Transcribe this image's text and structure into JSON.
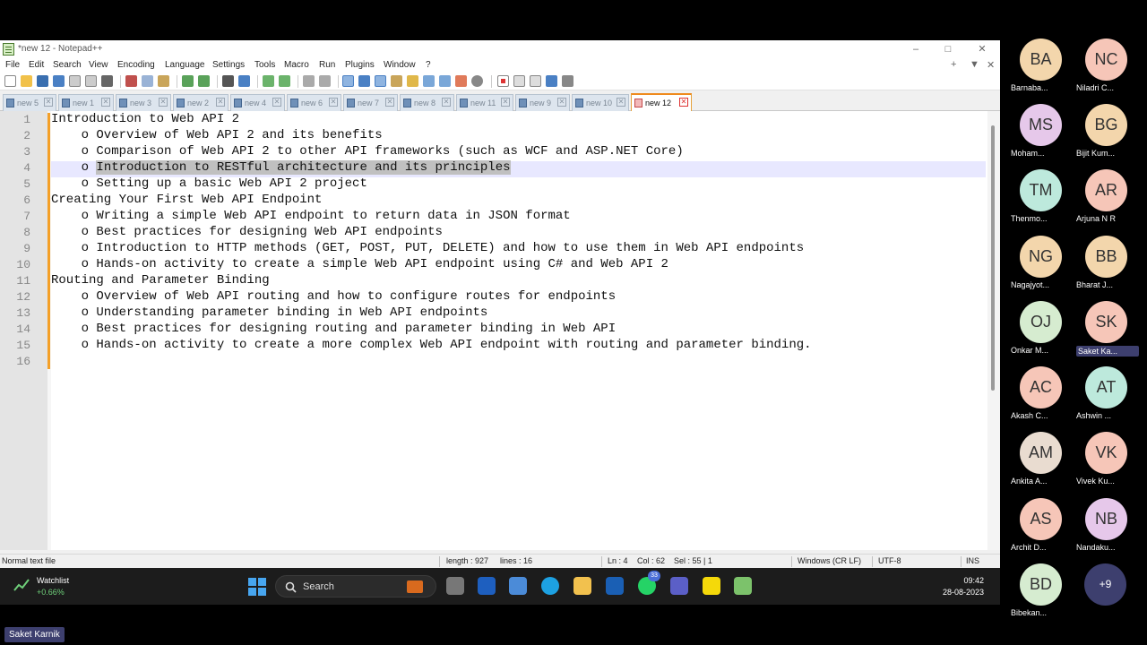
{
  "window": {
    "title": "*new 12 - Notepad++",
    "minimize": "–",
    "maximize": "□",
    "close": "✕"
  },
  "menu": [
    "File",
    "Edit",
    "Search",
    "View",
    "Encoding",
    "Language",
    "Settings",
    "Tools",
    "Macro",
    "Run",
    "Plugins",
    "Window",
    "?"
  ],
  "menu_right": [
    "+",
    "▼",
    "✕"
  ],
  "tabs": [
    {
      "label": "new 5"
    },
    {
      "label": "new 1"
    },
    {
      "label": "new 3"
    },
    {
      "label": "new 2"
    },
    {
      "label": "new 4"
    },
    {
      "label": "new 6"
    },
    {
      "label": "new 7"
    },
    {
      "label": "new 8"
    },
    {
      "label": "new 11"
    },
    {
      "label": "new 9"
    },
    {
      "label": "new 10"
    },
    {
      "label": "new 12"
    }
  ],
  "tab_close": "✕",
  "editor": {
    "lines": [
      "Introduction to Web API 2",
      "    o Overview of Web API 2 and its benefits",
      "    o Comparison of Web API 2 to other API frameworks (such as WCF and ASP.NET Core)",
      "    o ",
      "    o Setting up a basic Web API 2 project",
      "Creating Your First Web API Endpoint",
      "    o Writing a simple Web API endpoint to return data in JSON format",
      "    o Best practices for designing Web API endpoints",
      "    o Introduction to HTTP methods (GET, POST, PUT, DELETE) and how to use them in Web API endpoints",
      "    o Hands-on activity to create a simple Web API endpoint using C# and Web API 2",
      "Routing and Parameter Binding",
      "    o Overview of Web API routing and how to configure routes for endpoints",
      "    o Understanding parameter binding in Web API endpoints",
      "    o Best practices for designing routing and parameter binding in Web API",
      "    o Hands-on activity to create a more complex Web API endpoint with routing and parameter binding.",
      ""
    ],
    "selected_text": "Introduction to RESTful architecture and its principles",
    "current_line": 4
  },
  "status": {
    "file_type": "Normal text file",
    "length": "length : 927",
    "lines": "lines : 16",
    "ln": "Ln : 4",
    "col": "Col : 62",
    "sel": "Sel : 55 | 1",
    "eol": "Windows (CR LF)",
    "encoding": "UTF-8",
    "mode": "INS"
  },
  "taskbar": {
    "widget_name": "Watchlist",
    "widget_value": "+0.66%",
    "search": "Search",
    "badge": "33",
    "time": "09:42",
    "date": "28-08-2023"
  },
  "presenter": "Saket Karnik",
  "participants": [
    {
      "initials": "BA",
      "name": "Barnaba...",
      "color": "#f3d6ac"
    },
    {
      "initials": "NC",
      "name": "Niladri C...",
      "color": "#f6c6b8"
    },
    {
      "initials": "MS",
      "name": "Moham...",
      "color": "#e6c8ea"
    },
    {
      "initials": "BG",
      "name": "Bijit Kum...",
      "color": "#f3d6ac"
    },
    {
      "initials": "TM",
      "name": "Thenmo...",
      "color": "#bde9dc"
    },
    {
      "initials": "AR",
      "name": "Arjuna N R",
      "color": "#f6c6b8"
    },
    {
      "initials": "NG",
      "name": "Nagajyot...",
      "color": "#f3d6ac"
    },
    {
      "initials": "BB",
      "name": "Bharat J...",
      "color": "#f3d6ac"
    },
    {
      "initials": "OJ",
      "name": "Onkar M...",
      "color": "#d6ecd0"
    },
    {
      "initials": "SK",
      "name": "Saket Ka...",
      "color": "#f6c6b8"
    },
    {
      "initials": "AC",
      "name": "Akash C...",
      "color": "#f6c6b8"
    },
    {
      "initials": "AT",
      "name": "Ashwin ...",
      "color": "#bde9dc"
    },
    {
      "initials": "AM",
      "name": "Ankita A...",
      "color": "#e9dcd0"
    },
    {
      "initials": "VK",
      "name": "Vivek Ku...",
      "color": "#f6c6b8"
    },
    {
      "initials": "AS",
      "name": "Archit D...",
      "color": "#f6c6b8"
    },
    {
      "initials": "NB",
      "name": "Nandaku...",
      "color": "#e6c8ea"
    },
    {
      "initials": "BD",
      "name": "Bibekan...",
      "color": "#d6ecd0"
    }
  ],
  "more_participants": "+9",
  "colors": {
    "change_bar": "#f4a028",
    "current_line": "#e8e8ff",
    "selection": "#c0c0c0",
    "accent": "#3d3f6e"
  }
}
